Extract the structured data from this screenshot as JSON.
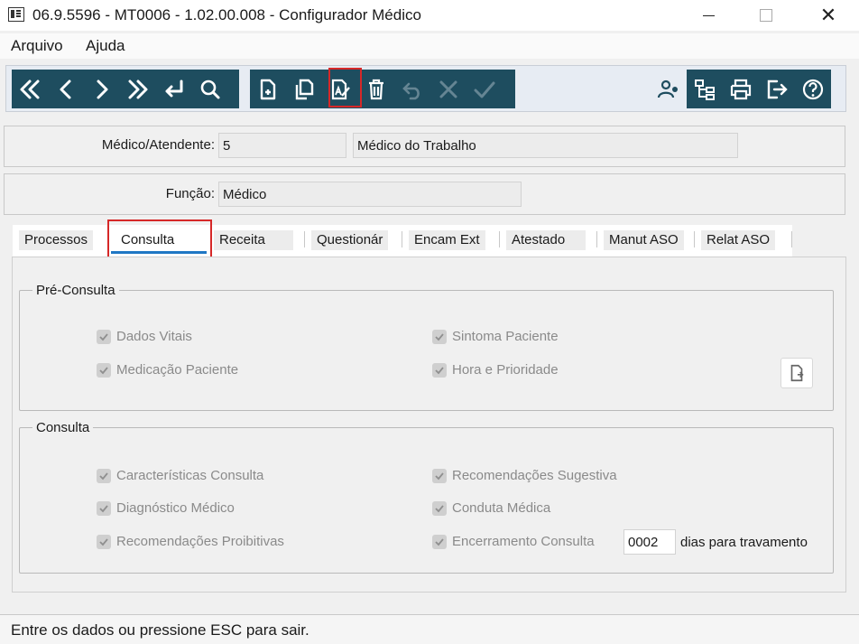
{
  "window": {
    "title": "06.9.5596 - MT0006 - 1.02.00.008 - Configurador Médico",
    "close_symbol": "✕"
  },
  "menu": {
    "items": [
      "Arquivo",
      "Ajuda"
    ]
  },
  "toolbar": {
    "nav_icons": [
      "first-record-icon",
      "previous-record-icon",
      "next-record-icon",
      "last-record-icon",
      "goto-icon",
      "search-icon"
    ],
    "edit_icons": [
      "new-icon",
      "copy-icon",
      "edit-icon",
      "delete-icon",
      "undo-icon",
      "cancel-icon",
      "confirm-icon"
    ],
    "right_icons": [
      "user-settings-icon",
      "structure-icon",
      "print-icon",
      "exit-icon",
      "help-icon"
    ],
    "highlighted": "edit-icon"
  },
  "fields": {
    "medico": {
      "label": "Médico/Atendente:",
      "code": "5",
      "description": "Médico do Trabalho"
    },
    "funcao": {
      "label": "Função:",
      "value": "Médico"
    }
  },
  "tabs": [
    {
      "label": "Processos",
      "active": false
    },
    {
      "label": "Consulta",
      "active": true
    },
    {
      "label": "Receita",
      "active": false
    },
    {
      "label": "Questionár",
      "active": false
    },
    {
      "label": "Encam Ext",
      "active": false
    },
    {
      "label": "Atestado",
      "active": false
    },
    {
      "label": "Manut ASO",
      "active": false
    },
    {
      "label": "Relat ASO",
      "active": false
    }
  ],
  "pre_consulta": {
    "title": "Pré-Consulta",
    "items": [
      {
        "label": "Dados Vitais",
        "checked": true
      },
      {
        "label": "Sintoma Paciente",
        "checked": true
      },
      {
        "label": "Medicação Paciente",
        "checked": true
      },
      {
        "label": "Hora e Prioridade",
        "checked": true
      }
    ]
  },
  "consulta": {
    "title": "Consulta",
    "items": [
      {
        "label": "Características Consulta",
        "checked": true
      },
      {
        "label": "Recomendações Sugestiva",
        "checked": true
      },
      {
        "label": "Diagnóstico Médico",
        "checked": true
      },
      {
        "label": "Conduta Médica",
        "checked": true
      },
      {
        "label": "Recomendações Proibitivas",
        "checked": true
      },
      {
        "label": "Encerramento Consulta",
        "checked": true
      }
    ],
    "dias_value": "0002",
    "dias_label": "dias para travamento"
  },
  "status": {
    "text": "Entre os dados ou pressione ESC para sair."
  },
  "colors": {
    "toolbar_bg": "#1e4d5f",
    "highlight": "#d62828",
    "tab_underline": "#1f77c4"
  }
}
